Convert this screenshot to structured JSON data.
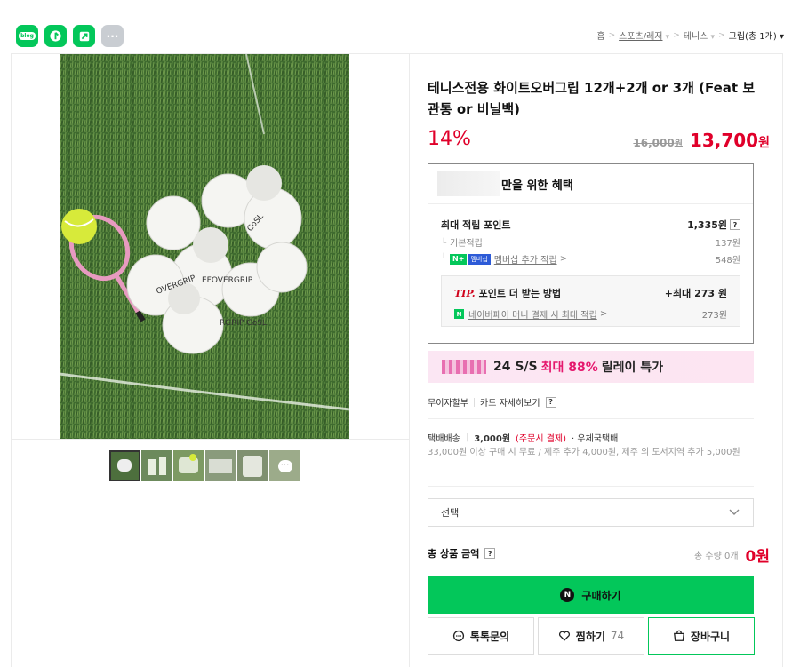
{
  "share": {
    "blog_label": "blog",
    "more_label": "···"
  },
  "breadcrumb": {
    "items": [
      "홈",
      "스포츠/레저",
      "테니스",
      "그립(총 1개)"
    ]
  },
  "product": {
    "title": "테니스전용 화이트오버그립 12개+2개 or 3개 (Feat 보관통 or 비닐백)",
    "discount": "14%",
    "original_price": "16,000",
    "original_unit": "원",
    "sale_price": "13,700",
    "sale_unit": "원"
  },
  "benefit": {
    "header": "만을 위한 혜택",
    "max_points_label": "최대 적립 포인트",
    "max_points_value": "1,335원",
    "basic_label": "기본적립",
    "basic_value": "137원",
    "membership_n": "N+",
    "membership_pill": "멤버십",
    "membership_label": "멤버십 추가 적립",
    "membership_value": "548원",
    "tip_mark": "TIP.",
    "tip_label": "포인트 더 받는 방법",
    "tip_value": "+최대 273 원",
    "naverpay_label": "네이버페이 머니 결제 시 최대 적립",
    "naverpay_value": "273원"
  },
  "banner": {
    "text_pre": "24 S/S",
    "highlight": "최대 88%",
    "text_post": "릴레이 특가"
  },
  "installment": {
    "label": "무이자할부",
    "card_label": "카드 자세히보기"
  },
  "shipping": {
    "type": "택배배송",
    "fee": "3,000원",
    "fee_note": "(주문시 결제)",
    "carrier": "· 우체국택배",
    "note": "33,000원 이상 구매 시 무료 / 제주 추가 4,000원, 제주 외 도서지역 추가 5,000원"
  },
  "option": {
    "placeholder": "선택"
  },
  "total": {
    "label": "총 상품 금액",
    "qty": "총 수량 0개",
    "amount": "0원"
  },
  "actions": {
    "buy": "구매하기",
    "talk": "톡톡문의",
    "wish": "찜하기",
    "wish_count": "74",
    "cart": "장바구니"
  },
  "colors": {
    "naver_green": "#03c75a",
    "price_red": "#e0002a",
    "banner_pink": "#e5186d"
  }
}
